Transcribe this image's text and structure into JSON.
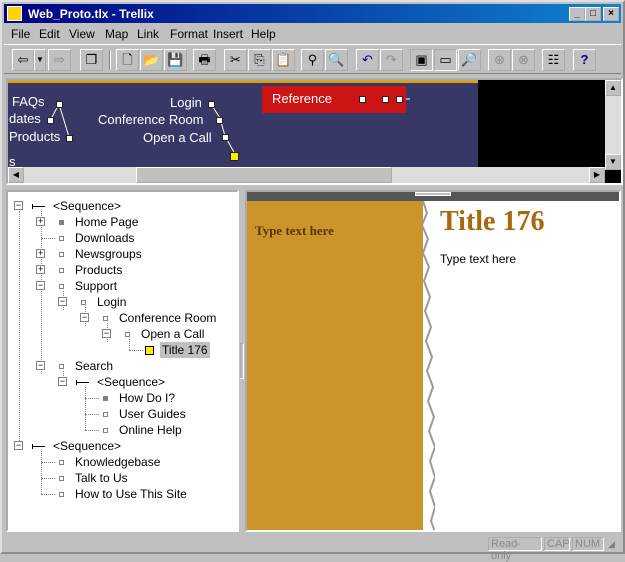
{
  "window": {
    "title": "Web_Proto.tlx - Trellix",
    "minimize": "_",
    "maximize": "□",
    "close": "×"
  },
  "menu": [
    "File",
    "Edit",
    "View",
    "Map",
    "Link",
    "Format",
    "Insert",
    "Help"
  ],
  "map": {
    "labels": {
      "faqs": "FAQs",
      "updates": "dates",
      "products": "Products",
      "s": "s",
      "login": "Login",
      "conference": "Conference Room",
      "open_call": "Open a Call",
      "reference": "Reference"
    },
    "colors": {
      "background": "#383866",
      "reference_box": "#cc1414",
      "top_border": "#d6a020",
      "selected_node": "#ffee00"
    }
  },
  "tree": {
    "items": [
      {
        "label": "<Sequence>"
      },
      {
        "label": "Home Page"
      },
      {
        "label": "Downloads"
      },
      {
        "label": "Newsgroups"
      },
      {
        "label": "Products"
      },
      {
        "label": "Support"
      },
      {
        "label": "Login"
      },
      {
        "label": "Conference Room"
      },
      {
        "label": "Open a Call"
      },
      {
        "label": "Title 176"
      },
      {
        "label": "Search"
      },
      {
        "label": "<Sequence>"
      },
      {
        "label": "How Do I?"
      },
      {
        "label": "User Guides"
      },
      {
        "label": "Online Help"
      },
      {
        "label": "<Sequence>"
      },
      {
        "label": "Knowledgebase"
      },
      {
        "label": "Talk to Us"
      },
      {
        "label": "How to Use This Site"
      }
    ]
  },
  "page": {
    "sidebar_text": "Type text here",
    "title": "Title 176",
    "body_text": "Type text here",
    "colors": {
      "sidebar": "#cc952c",
      "title": "#a6690e"
    }
  },
  "status": {
    "readonly": "Read-only",
    "cap": "CAP",
    "num": "NUM"
  }
}
